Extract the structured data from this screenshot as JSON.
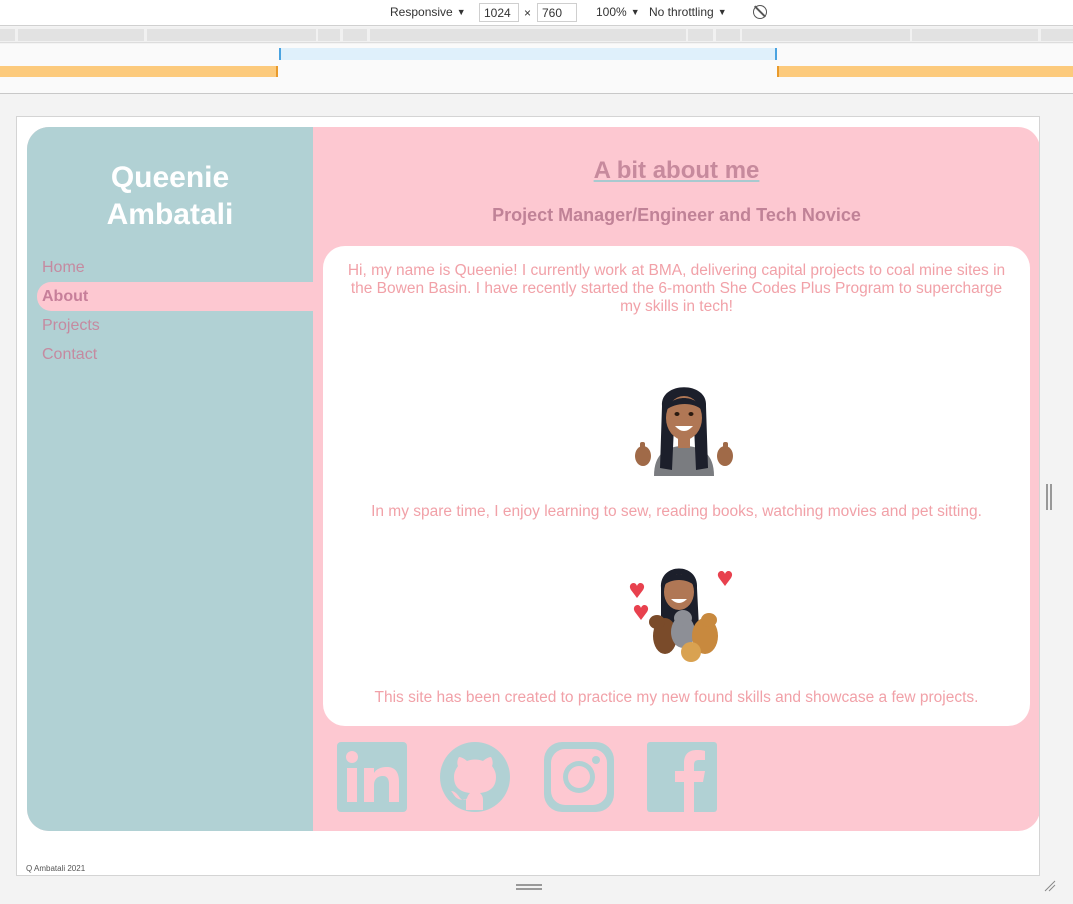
{
  "devtools": {
    "device": "Responsive",
    "width": "1024",
    "height": "760",
    "times": "×",
    "zoom": "100%",
    "throttling": "No throttling"
  },
  "site": {
    "name_line1": "Queenie",
    "name_line2": "Ambatali",
    "nav": [
      {
        "label": "Home",
        "active": false
      },
      {
        "label": "About",
        "active": true
      },
      {
        "label": "Projects",
        "active": false
      },
      {
        "label": "Contact",
        "active": false
      }
    ],
    "heading": "A bit about me",
    "subheading": "Project Manager/Engineer and Tech Novice",
    "intro": "Hi, my name is Queenie! I currently work at BMA, delivering capital projects to coal mine sites in the Bowen Basin. I have recently started the 6-month She Codes Plus Program to supercharge my skills in tech!",
    "hobbies": "In my spare time, I enjoy learning to sew, reading books, watching movies and pet sitting.",
    "purpose": "This site has been created to practice my new found skills and showcase a few projects.",
    "social": [
      "linkedin-icon",
      "github-icon",
      "instagram-icon",
      "facebook-icon"
    ],
    "footer": "Q Ambatali 2021"
  },
  "colors": {
    "sidebar": "#b1d1d4",
    "main": "#fdc8d1",
    "text_pink": "#f1a1a8",
    "heading": "#c78a9d"
  }
}
